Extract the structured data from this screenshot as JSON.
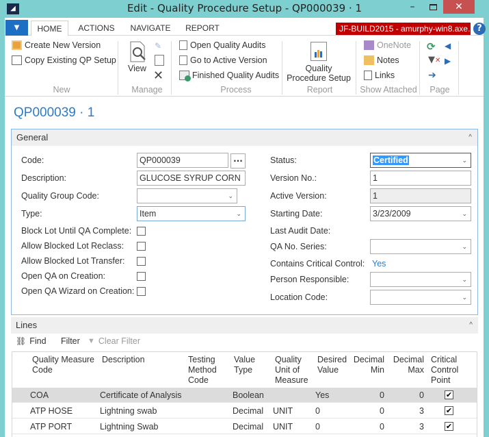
{
  "window": {
    "title": "Edit - Quality Procedure Setup - QP000039 · 1",
    "minimize": "–",
    "close": "✕",
    "logo": "◢"
  },
  "ribbon_tabs": [
    {
      "label": "HOME",
      "active": true
    },
    {
      "label": "ACTIONS"
    },
    {
      "label": "NAVIGATE"
    },
    {
      "label": "REPORT"
    }
  ],
  "app_menu_icon": "▼",
  "server_badge": "JF-BUILD2015 - amurphy-win8.axe...",
  "help_icon": "?",
  "ribbon": {
    "new": {
      "label": "New",
      "items": [
        "Create New Version",
        "Copy Existing QP Setup"
      ]
    },
    "manage": {
      "label": "Manage",
      "view": "View"
    },
    "process": {
      "label": "Process",
      "items": [
        "Open Quality Audits",
        "Go to Active Version",
        "Finished Quality Audits"
      ]
    },
    "report": {
      "label": "Report",
      "item_line1": "Quality",
      "item_line2": "Procedure Setup"
    },
    "show_attached": {
      "label": "Show Attached",
      "items": [
        "OneNote",
        "Notes",
        "Links"
      ]
    },
    "page": {
      "label": "Page"
    }
  },
  "page_title": "QP000039 · 1",
  "general": {
    "title": "General",
    "collapse_icon": "^",
    "left": {
      "code": {
        "label": "Code:",
        "value": "QP000039",
        "assist": "..."
      },
      "description": {
        "label": "Description:",
        "value": "GLUCOSE SYRUP CORN"
      },
      "quality_group_code": {
        "label": "Quality Group Code:",
        "value": ""
      },
      "type": {
        "label": "Type:",
        "value": "Item"
      },
      "block_lot": {
        "label": "Block Lot Until QA Complete:",
        "checked": false
      },
      "allow_reclass": {
        "label": "Allow Blocked Lot Reclass:",
        "checked": false
      },
      "allow_transfer": {
        "label": "Allow Blocked Lot Transfer:",
        "checked": false
      },
      "open_qa": {
        "label": "Open QA on Creation:",
        "checked": false
      },
      "open_wizard": {
        "label": "Open QA Wizard on Creation:",
        "checked": false
      }
    },
    "right": {
      "status": {
        "label": "Status:",
        "value": "Certified"
      },
      "version_no": {
        "label": "Version No.:",
        "value": "1"
      },
      "active_version": {
        "label": "Active Version:",
        "value": "1"
      },
      "starting_date": {
        "label": "Starting Date:",
        "value": "3/23/2009"
      },
      "last_audit_date": {
        "label": "Last Audit Date:",
        "value": ""
      },
      "qa_no_series": {
        "label": "QA No. Series:",
        "value": ""
      },
      "contains_critical": {
        "label": "Contains Critical Control:",
        "value": "Yes"
      },
      "person_responsible": {
        "label": "Person Responsible:",
        "value": ""
      },
      "location_code": {
        "label": "Location Code:",
        "value": ""
      }
    },
    "dropdown_arrow": "⌄"
  },
  "lines": {
    "title": "Lines",
    "toolbar": {
      "find": "Find",
      "filter": "Filter",
      "clear_filter": "Clear Filter"
    },
    "columns": [
      {
        "l1": "Quality Measure",
        "l2": "Code",
        "l3": ""
      },
      {
        "l1": "Description",
        "l2": "",
        "l3": ""
      },
      {
        "l1": "Testing",
        "l2": "Method",
        "l3": "Code"
      },
      {
        "l1": "Value",
        "l2": "Type",
        "l3": ""
      },
      {
        "l1": "Quality",
        "l2": "Unit of",
        "l3": "Measure"
      },
      {
        "l1": "Desired",
        "l2": "Value",
        "l3": ""
      },
      {
        "l1": "Decimal",
        "l2": "Min",
        "l3": ""
      },
      {
        "l1": "Decimal",
        "l2": "Max",
        "l3": ""
      },
      {
        "l1": "Critical",
        "l2": "Control",
        "l3": "Point"
      }
    ],
    "rows": [
      {
        "code": "COA",
        "description": "Certificate of Analysis",
        "testing_method": "",
        "value_type": "Boolean",
        "uom": "",
        "desired": "Yes",
        "min": "0",
        "max": "0",
        "critical": true,
        "check": "✔"
      },
      {
        "code": "ATP HOSE",
        "description": "Lightning swab",
        "testing_method": "",
        "value_type": "Decimal",
        "uom": "UNIT",
        "desired": "0",
        "min": "0",
        "max": "3",
        "critical": true,
        "check": "✔"
      },
      {
        "code": "ATP PORT",
        "description": "Lightning Swab",
        "testing_method": "",
        "value_type": "Decimal",
        "uom": "UNIT",
        "desired": "0",
        "min": "0",
        "max": "3",
        "critical": true,
        "check": "✔"
      }
    ]
  }
}
